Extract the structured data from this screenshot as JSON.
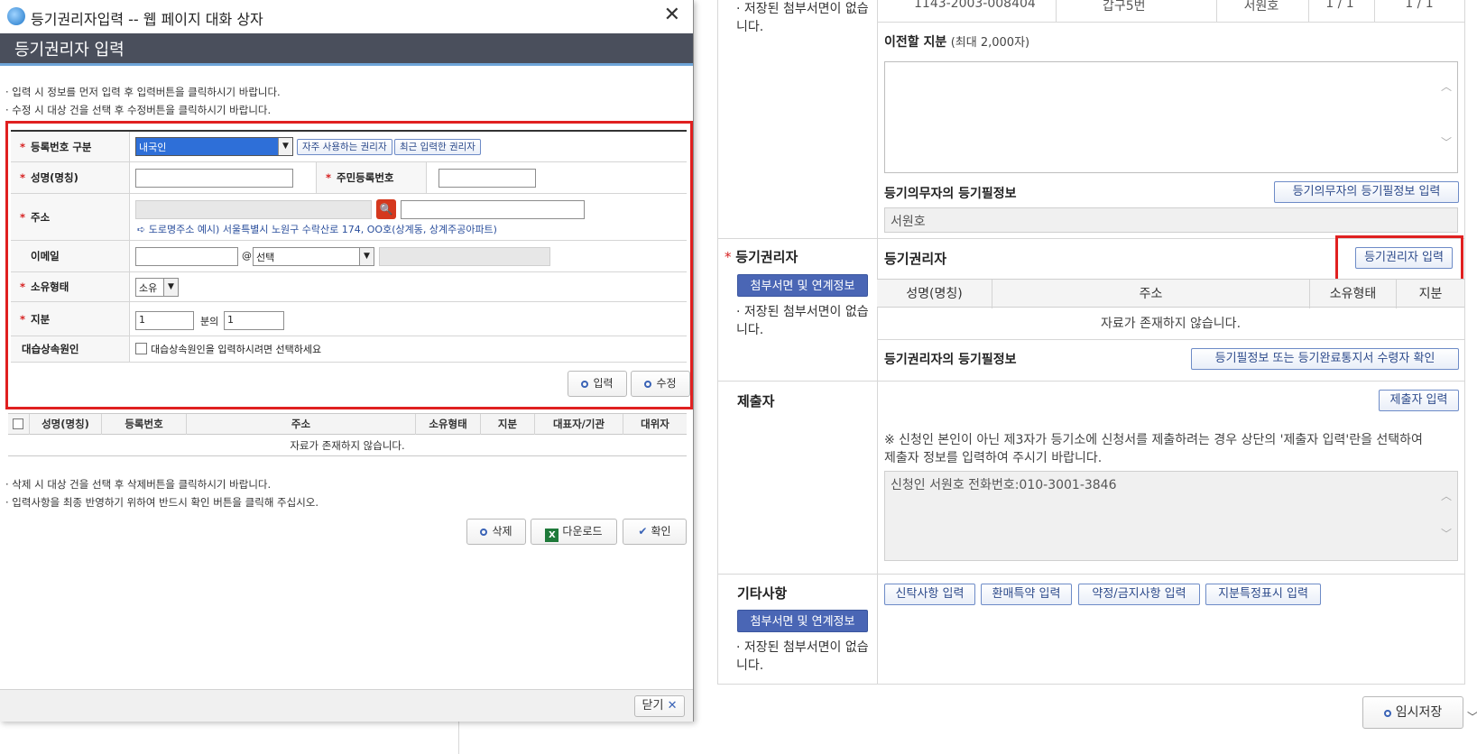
{
  "dialog": {
    "window_title": "등기권리자입력 -- 웹 페이지 대화 상자",
    "header_title": "등기권리자 입력",
    "notes_top": [
      "· 입력 시 정보를 먼저 입력 후 입력버튼을 클릭하시기 바랍니다.",
      "· 수정 시 대상 건을 선택 후 수정버튼을 클릭하시기 바랍니다."
    ],
    "form": {
      "reg_type_label": "등록번호 구분",
      "reg_type_value": "내국인",
      "frequent_btn": "자주 사용하는 권리자",
      "recent_btn": "최근 입력한 권리자",
      "name_label": "성명(명칭)",
      "rrn_label": "주민등록번호",
      "address_label": "주소",
      "address_hint": "도로명주소 예시) 서울특별시 노원구 수락산로 174, OO호(상계동, 상계주공아파트)",
      "email_label": "이메일",
      "email_at": "@",
      "email_domain_value": "선택",
      "ownership_label": "소유형태",
      "ownership_value": "소유",
      "share_label": "지분",
      "share_denominator": "1",
      "share_of": "분의",
      "share_numerator": "1",
      "heir_label": "대습상속원인",
      "heir_checkbox_text": "대습상속원인을 입력하시려면 선택하세요",
      "input_btn": "입력",
      "edit_btn": "수정"
    },
    "list": {
      "columns": [
        "성명(명칭)",
        "등록번호",
        "주소",
        "소유형태",
        "지분",
        "대표자/기관",
        "대위자"
      ],
      "empty_text": "자료가 존재하지 않습니다."
    },
    "notes_bottom": [
      "· 삭제 시 대상 건을 선택 후 삭제버튼을 클릭하시기 바랍니다.",
      "· 입력사항을 최종 반영하기 위하여 반드시 확인 버튼을 클릭해 주십시오."
    ],
    "delete_btn": "삭제",
    "download_btn": "다운로드",
    "confirm_btn": "확인",
    "close_btn": "닫기"
  },
  "page": {
    "top_row": {
      "number": "1143-2003-008404",
      "section": "갑구5번",
      "name": "서원호",
      "ratio1": "1 / 1",
      "ratio2": "1 / 1",
      "saved_note": "· 저장된 첨부서면이 없습니다."
    },
    "transfer_share_label": "이전할 지분",
    "transfer_share_hint": "(최대 2,000자)",
    "obligor_cert_label": "등기의무자의 등기필정보",
    "obligor_cert_btn": "등기의무자의 등기필정보 입력",
    "obligor_cert_value": "서원호",
    "rightholder_section": {
      "label": "등기권리자",
      "attach_btn": "첨부서면 및 연계정보",
      "saved_note": "· 저장된 첨부서면이 없습니다.",
      "title": "등기권리자",
      "input_btn": "등기권리자 입력",
      "columns": [
        "성명(명칭)",
        "주소",
        "소유형태",
        "지분"
      ],
      "empty_text": "자료가 존재하지 않습니다.",
      "cert_label": "등기권리자의 등기필정보",
      "cert_btn": "등기필정보 또는 등기완료통지서 수령자 확인"
    },
    "submitter_section": {
      "label": "제출자",
      "input_btn": "제출자 입력",
      "notice_line1": "※ 신청인 본인이 아닌 제3자가 등기소에 신청서를 제출하려는 경우 상단의 '제출자 입력'란을 선택하여",
      "notice_line2": "제출자 정보를 입력하여 주시기 바랍니다.",
      "value": "신청인 서원호 전화번호:010-3001-3846"
    },
    "other_section": {
      "label": "기타사항",
      "attach_btn": "첨부서면 및 연계정보",
      "saved_note": "· 저장된 첨부서면이 없습니다.",
      "buttons": [
        "신탁사항 입력",
        "환매특약 입력",
        "약정/금지사항 입력",
        "지분특정표시 입력"
      ]
    },
    "temp_save_btn": "임시저장"
  }
}
